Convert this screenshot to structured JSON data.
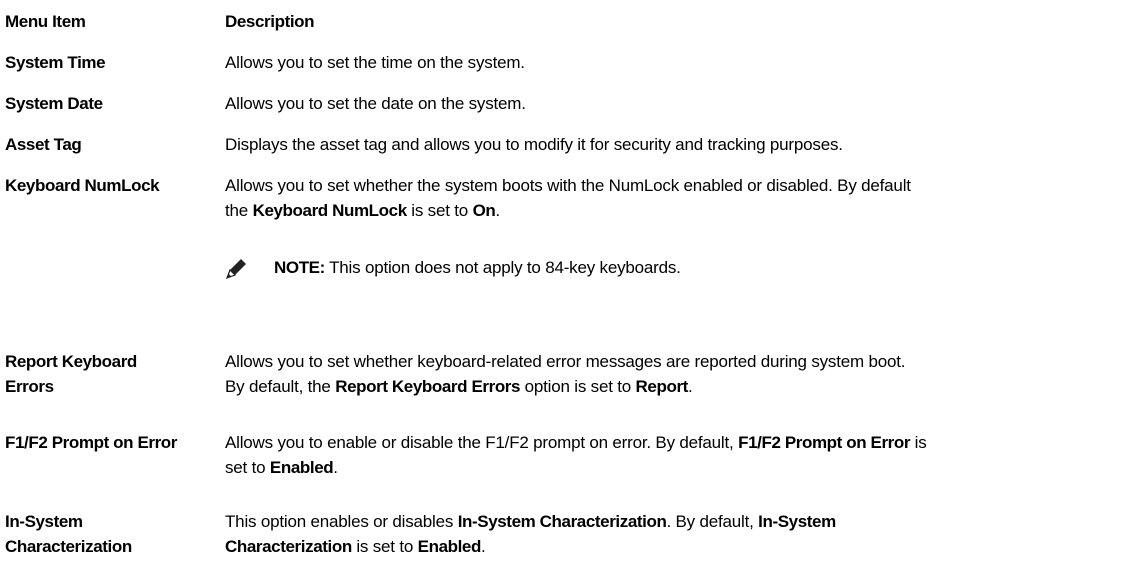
{
  "table": {
    "header": {
      "item": "Menu Item",
      "description": "Description"
    },
    "rows": [
      {
        "item": "System Time",
        "desc": "Allows you to set the time on the system."
      },
      {
        "item": "System Date",
        "desc": "Allows you to set the date on the system."
      },
      {
        "item": "Asset Tag",
        "desc": "Displays the asset tag and allows you to modify it for security and tracking purposes."
      },
      {
        "item": "Keyboard NumLock",
        "desc_a": "Allows you to set whether the system boots with the NumLock enabled or disabled. By default",
        "desc_b": "the ",
        "desc_b_bold": "Keyboard NumLock",
        "desc_c": " is set to ",
        "desc_c_bold": "On",
        "desc_d": ".",
        "note_label": "NOTE:",
        "note_text": " This option does not apply to 84-key keyboards."
      },
      {
        "item_line1": "Report Keyboard",
        "item_line2": "Errors",
        "desc_a": "Allows you to set whether keyboard-related error messages are reported during system boot.",
        "desc_b": "By default, the ",
        "desc_b_bold": "Report Keyboard Errors",
        "desc_c": " option is set to ",
        "desc_c_bold": "Report",
        "desc_d": "."
      },
      {
        "item": "F1/F2 Prompt on Error",
        "desc_a": "Allows you to enable or disable the F1/F2 prompt on error. By default, ",
        "desc_a_bold": "F1/F2 Prompt on Error",
        "desc_a2": " is",
        "desc_b": "set to ",
        "desc_b_bold": "Enabled",
        "desc_c": "."
      },
      {
        "item_line1": "In-System",
        "item_line2": "Characterization",
        "desc_a": "This option enables or disables ",
        "desc_a_bold": "In-System Characterization",
        "desc_a2": ". By default, ",
        "desc_a_bold2": "In-System",
        "desc_b_bold": "Characterization",
        "desc_b": " is set to ",
        "desc_b_bold2": "Enabled",
        "desc_c": "."
      }
    ]
  }
}
